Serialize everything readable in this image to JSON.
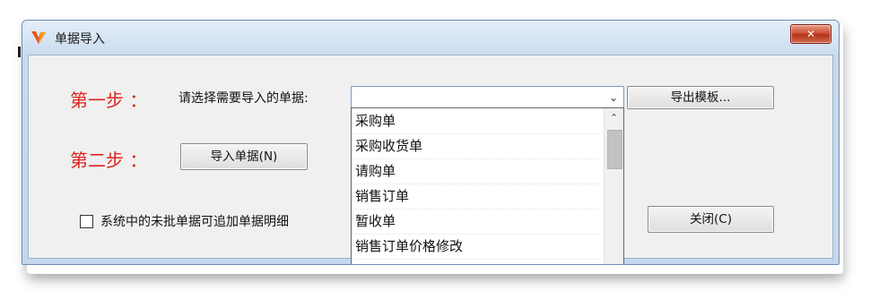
{
  "window": {
    "title": "单据导入",
    "close_label": "✕"
  },
  "steps": {
    "step1": "第一步 ：",
    "step2": "第二步 ："
  },
  "select_label": "请选择需要导入的单据:",
  "buttons": {
    "export_template": "导出模板...",
    "import_document": "导入单据(N)",
    "close": "关闭(C)"
  },
  "dropdown": {
    "selected_value": "",
    "options": [
      "采购单",
      "采购收货单",
      "请购单",
      "销售订单",
      "暂收单",
      "销售订单价格修改"
    ]
  },
  "checkbox": {
    "label": "系统中的未批单据可追加单据明细",
    "checked": false
  },
  "colors": {
    "step_red": "#e0221b",
    "close_button": "#c7452b"
  }
}
